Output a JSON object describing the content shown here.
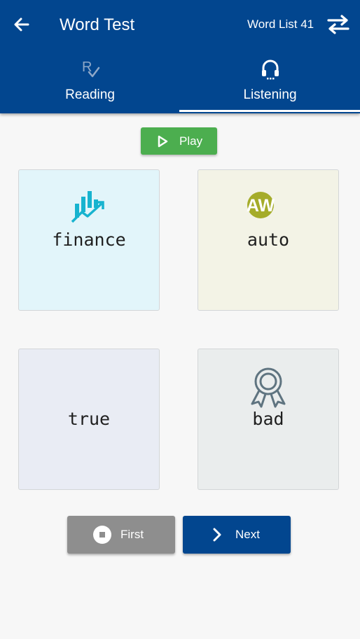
{
  "header": {
    "title": "Word Test",
    "word_list": "Word List 41",
    "back_icon": "arrow-left-icon",
    "swap_icon": "swap-arrows-icon"
  },
  "tabs": [
    {
      "label": "Reading",
      "icon": "reading-icon",
      "selected": false
    },
    {
      "label": "Listening",
      "icon": "headphones-icon",
      "selected": true
    }
  ],
  "play": {
    "label": "Play",
    "icon": "play-icon"
  },
  "cards": [
    {
      "word": "finance",
      "icon": "finance-chart-icon"
    },
    {
      "word": "auto",
      "icon": "aw-badge-icon",
      "icon_text": "AW"
    },
    {
      "word": "true"
    },
    {
      "word": "bad",
      "icon": "award-ribbon-icon"
    }
  ],
  "buttons": {
    "first_label": "First",
    "next_label": "Next"
  },
  "colors": {
    "primary": "#02468f",
    "play": "#4cae4f",
    "finance_icon": "#17b3cf",
    "aw_icon": "#a5ac2a",
    "award_icon": "#5f7480",
    "reading_icon": "#8fa8c8"
  }
}
